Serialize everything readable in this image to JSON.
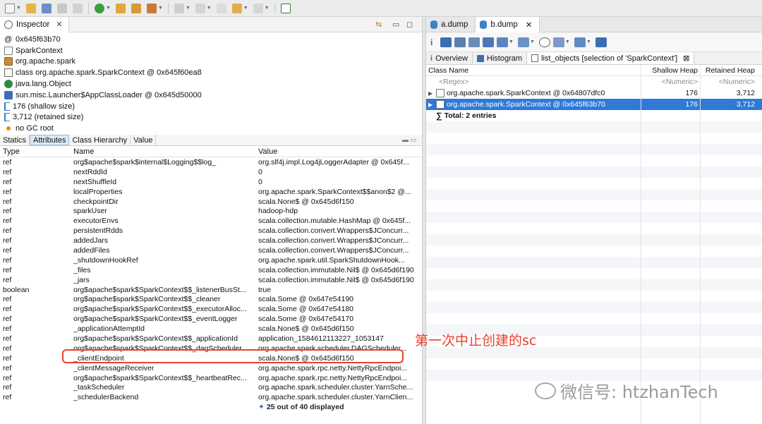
{
  "inspector": {
    "tab_label": "Inspector",
    "details": [
      {
        "icon": "at-icon",
        "text": "0x645f63b70"
      },
      {
        "icon": "document-icon",
        "text": "SparkContext"
      },
      {
        "icon": "package-icon",
        "text": "org.apache.spark"
      },
      {
        "icon": "class-icon",
        "text": "class org.apache.spark.SparkContext @ 0x645f60ea8"
      },
      {
        "icon": "java-object-icon",
        "text": "java.lang.Object"
      },
      {
        "icon": "classloader-icon",
        "text": "sun.misc.Launcher$AppClassLoader @ 0x645d50000"
      },
      {
        "icon": "shallow-size-icon",
        "text": "176 (shallow size)"
      },
      {
        "icon": "retained-size-icon",
        "text": "3,712 (retained size)"
      },
      {
        "icon": "gc-root-icon",
        "text": "no GC root"
      }
    ],
    "subtabs": [
      "Statics",
      "Attributes",
      "Class Hierarchy",
      "Value"
    ],
    "active_subtab": "Attributes",
    "columns": {
      "type": "Type",
      "name": "Name",
      "value": "Value"
    },
    "rows": [
      {
        "type": "ref",
        "name": "org$apache$spark$internal$Logging$$log_",
        "value": "org.slf4j.impl.Log4jLoggerAdapter @ 0x645f..."
      },
      {
        "type": "ref",
        "name": "nextRddId",
        "value": "0"
      },
      {
        "type": "ref",
        "name": "nextShuffleId",
        "value": "0"
      },
      {
        "type": "ref",
        "name": "localProperties",
        "value": "org.apache.spark.SparkContext$$anon$2 @..."
      },
      {
        "type": "ref",
        "name": "checkpointDir",
        "value": "scala.None$ @ 0x645d6f150"
      },
      {
        "type": "ref",
        "name": "sparkUser",
        "value": "hadoop-hdp"
      },
      {
        "type": "ref",
        "name": "executorEnvs",
        "value": "scala.collection.mutable.HashMap @ 0x645f..."
      },
      {
        "type": "ref",
        "name": "persistentRdds",
        "value": "scala.collection.convert.Wrappers$JConcurr..."
      },
      {
        "type": "ref",
        "name": "addedJars",
        "value": "scala.collection.convert.Wrappers$JConcurr..."
      },
      {
        "type": "ref",
        "name": "addedFiles",
        "value": "scala.collection.convert.Wrappers$JConcurr..."
      },
      {
        "type": "ref",
        "name": "_shutdownHookRef",
        "value": "org.apache.spark.util.SparkShutdownHook..."
      },
      {
        "type": "ref",
        "name": "_files",
        "value": "scala.collection.immutable.Nil$ @ 0x645d6f190"
      },
      {
        "type": "ref",
        "name": "_jars",
        "value": "scala.collection.immutable.Nil$ @ 0x645d6f190"
      },
      {
        "type": "boolean",
        "name": "org$apache$spark$SparkContext$$_listenerBusSt...",
        "value": "true"
      },
      {
        "type": "ref",
        "name": "org$apache$spark$SparkContext$$_cleaner",
        "value": "scala.Some @ 0x647e54190"
      },
      {
        "type": "ref",
        "name": "org$apache$spark$SparkContext$$_executorAlloc...",
        "value": "scala.Some @ 0x647e54180"
      },
      {
        "type": "ref",
        "name": "org$apache$spark$SparkContext$$_eventLogger",
        "value": "scala.Some @ 0x647e54170"
      },
      {
        "type": "ref",
        "name": "_applicationAttemptId",
        "value": "scala.None$ @ 0x645d6f150"
      },
      {
        "type": "ref",
        "name": "org$apache$spark$SparkContext$$_applicationId",
        "value": "application_1584612113227_1053147"
      },
      {
        "type": "ref",
        "name": "org$apache$spark$SparkContext$$_dagScheduler",
        "value": "org.apache.spark.scheduler.DAGScheduler..."
      },
      {
        "type": "ref",
        "name": "_clientEndpoint",
        "value": "scala.None$ @ 0x645d6f150"
      },
      {
        "type": "ref",
        "name": "_clientMessageReceiver",
        "value": "org.apache.spark.rpc.netty.NettyRpcEndpoi..."
      },
      {
        "type": "ref",
        "name": "org$apache$spark$SparkContext$$_heartbeatRec...",
        "value": "org.apache.spark.rpc.netty.NettyRpcEndpoi..."
      },
      {
        "type": "ref",
        "name": "_taskScheduler",
        "value": "org.apache.spark.scheduler.cluster.YarnSche..."
      },
      {
        "type": "ref",
        "name": "_schedulerBackend",
        "value": "org.apache.spark.scheduler.cluster.YarnClien..."
      }
    ],
    "more_label": "25 out of 40 displayed"
  },
  "annotation": {
    "text": "第一次中止创建的sc",
    "color": "#e8412c"
  },
  "editor": {
    "tabs": [
      "a.dump",
      "b.dump"
    ],
    "active_tab": "b.dump",
    "result_tabs": [
      "Overview",
      "Histogram",
      "list_objects  [selection of 'SparkContext']"
    ],
    "active_result_tab": "list_objects  [selection of 'SparkContext']",
    "columns": {
      "name": "Class Name",
      "shallow": "Shallow Heap",
      "retained": "Retained Heap"
    },
    "filter_row": {
      "name": "<Regex>",
      "shallow": "<Numeric>",
      "retained": "<Numeric>"
    },
    "rows": [
      {
        "name": "org.apache.spark.SparkContext @ 0x64807dfc0",
        "shallow": "176",
        "retained": "3,712",
        "selected": false
      },
      {
        "name": "org.apache.spark.SparkContext @ 0x645f63b70",
        "shallow": "176",
        "retained": "3,712",
        "selected": true
      }
    ],
    "total_label": "Total: 2 entries"
  },
  "watermark": "微信号: htzhanTech",
  "colors": {
    "accent": "#2f7ad6",
    "highlight": "#e8412c"
  }
}
